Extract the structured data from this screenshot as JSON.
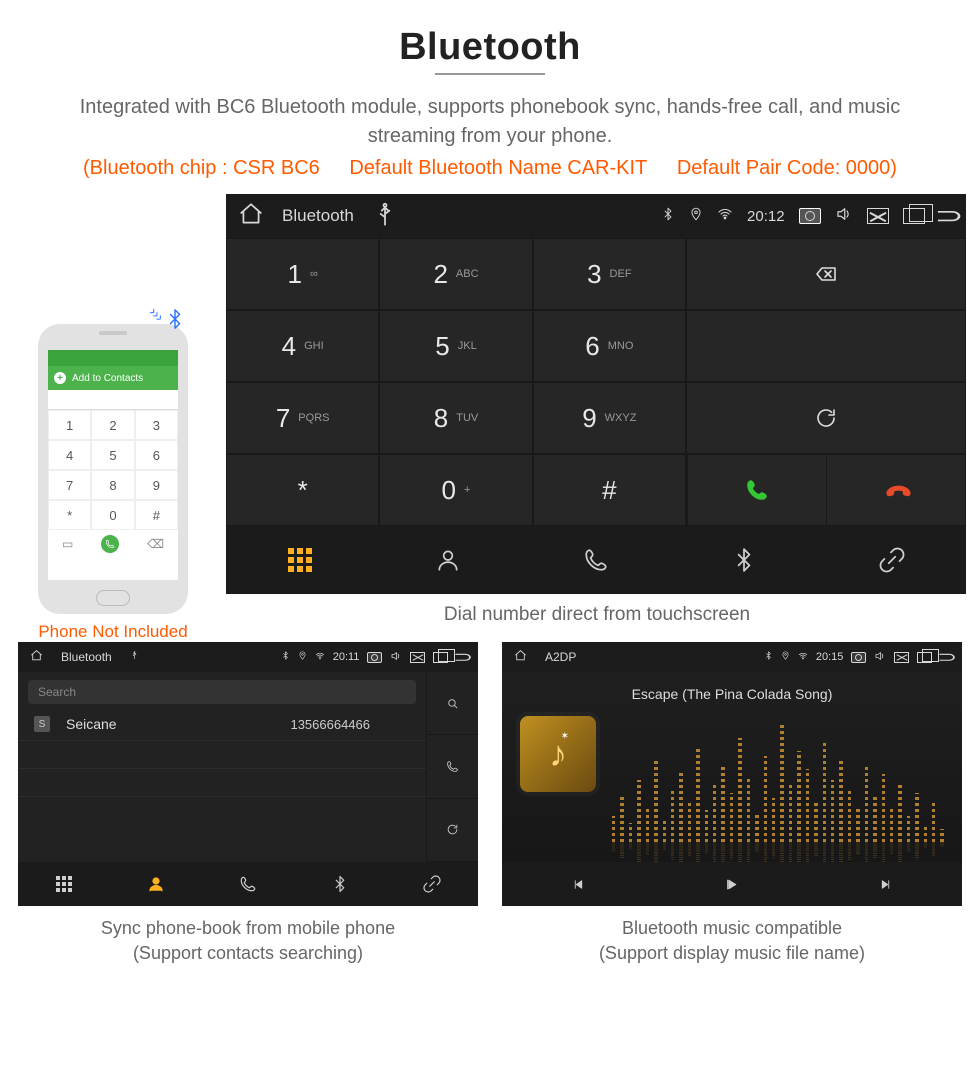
{
  "header": {
    "title": "Bluetooth",
    "description": "Integrated with BC6 Bluetooth module, supports phonebook sync, hands-free call, and music streaming from your phone.",
    "spec_chip": "(Bluetooth chip : CSR BC6",
    "spec_name": "Default Bluetooth Name CAR-KIT",
    "spec_code": "Default Pair Code: 0000)"
  },
  "phone_mock": {
    "add_contacts": "Add to Contacts",
    "keys": [
      "1",
      "2",
      "3",
      "4",
      "5",
      "6",
      "7",
      "8",
      "9",
      "*",
      "0",
      "#"
    ],
    "note": "Phone Not Included"
  },
  "main_hu": {
    "status": {
      "title": "Bluetooth",
      "time": "20:12"
    },
    "keys": [
      {
        "n": "1",
        "s": "∞"
      },
      {
        "n": "2",
        "s": "ABC"
      },
      {
        "n": "3",
        "s": "DEF"
      },
      {
        "n": "4",
        "s": "GHI"
      },
      {
        "n": "5",
        "s": "JKL"
      },
      {
        "n": "6",
        "s": "MNO"
      },
      {
        "n": "7",
        "s": "PQRS"
      },
      {
        "n": "8",
        "s": "TUV"
      },
      {
        "n": "9",
        "s": "WXYZ"
      },
      {
        "n": "*",
        "s": ""
      },
      {
        "n": "0",
        "s": "+"
      },
      {
        "n": "#",
        "s": ""
      }
    ],
    "caption": "Dial number direct from touchscreen"
  },
  "contacts_hu": {
    "status": {
      "title": "Bluetooth",
      "time": "20:11"
    },
    "search_placeholder": "Search",
    "row": {
      "badge": "S",
      "name": "Seicane",
      "number": "13566664466"
    },
    "caption_l1": "Sync phone-book from mobile phone",
    "caption_l2": "(Support contacts searching)"
  },
  "music_hu": {
    "status": {
      "title": "A2DP",
      "time": "20:15"
    },
    "track": "Escape (The Pina Colada Song)",
    "caption_l1": "Bluetooth music compatible",
    "caption_l2": "(Support display music file name)"
  }
}
